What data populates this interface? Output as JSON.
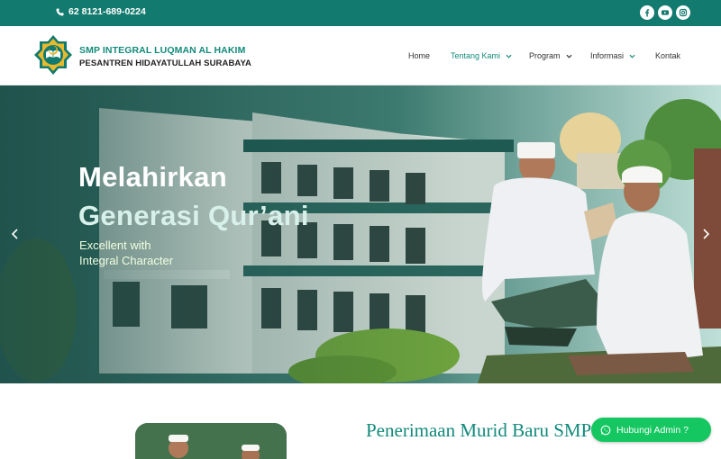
{
  "topbar": {
    "phone": "62 8121-689-0224",
    "socials": [
      "facebook-icon",
      "youtube-icon",
      "instagram-icon"
    ]
  },
  "brand": {
    "line1": "SMP INTEGRAL LUQMAN AL HAKIM",
    "line2": "PESANTREN HIDAYATULLAH SURABAYA"
  },
  "nav": {
    "items": [
      {
        "label": "Home",
        "dropdown": false
      },
      {
        "label": "Tentang Kami",
        "dropdown": true
      },
      {
        "label": "Program",
        "dropdown": true
      },
      {
        "label": "Informasi",
        "dropdown": true
      },
      {
        "label": "Kontak",
        "dropdown": false
      }
    ]
  },
  "hero": {
    "title_line1": "Melahirkan",
    "title_line2": "Generasi Qur’ani",
    "tagline_line1": "Excellent with",
    "tagline_line2": "Integral Character"
  },
  "section": {
    "title": "Penerimaan Murid Baru SMP"
  },
  "whatsapp": {
    "label": "Hubungi Admin ?"
  },
  "colors": {
    "teal": "#127a6e",
    "accent": "#138a7b",
    "whatsapp": "#14c760"
  }
}
